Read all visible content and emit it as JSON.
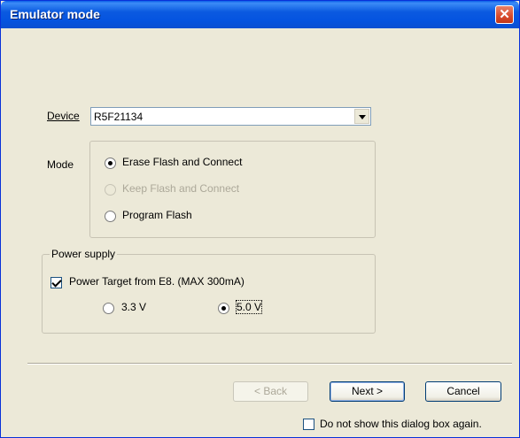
{
  "window": {
    "title": "Emulator mode",
    "close_label": "✕"
  },
  "device": {
    "label": "Device",
    "value": "R5F21134"
  },
  "mode": {
    "label": "Mode",
    "options": [
      {
        "label": "Erase Flash and Connect",
        "checked": true,
        "disabled": false
      },
      {
        "label": "Keep Flash and Connect",
        "checked": false,
        "disabled": true
      },
      {
        "label": "Program Flash",
        "checked": false,
        "disabled": false
      }
    ]
  },
  "power": {
    "group_label": "Power supply",
    "checkbox_label": "Power Target from E8. (MAX 300mA)",
    "checkbox_checked": true,
    "voltage_options": [
      {
        "label": "3.3 V",
        "checked": false
      },
      {
        "label": "5.0 V",
        "checked": true
      }
    ]
  },
  "buttons": {
    "back": "< Back",
    "next": "Next >",
    "cancel": "Cancel"
  },
  "footer": {
    "dont_show_label": "Do not show this dialog box again.",
    "checked": false
  }
}
